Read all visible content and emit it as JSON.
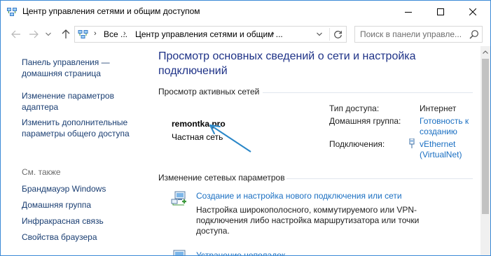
{
  "window": {
    "title": "Центр управления сетями и общим доступом"
  },
  "address": {
    "crumb1": "Все ...",
    "crumb2": "Центр управления сетями и общим ...",
    "search_placeholder": "Поиск в панели управле..."
  },
  "sidebar": {
    "links": [
      {
        "label": "Панель управления —\nдомашняя страница"
      },
      {
        "label": "Изменение параметров\nадаптера"
      },
      {
        "label": "Изменить дополнительные\nпараметры общего доступа"
      }
    ],
    "see_also_heading": "См. также",
    "see_also": [
      {
        "label": "Брандмауэр Windows"
      },
      {
        "label": "Домашняя группа"
      },
      {
        "label": "Инфракрасная связь"
      },
      {
        "label": "Свойства браузера"
      }
    ]
  },
  "main": {
    "title": "Просмотр основных сведений о сети и настройка подключений",
    "active_networks_heading": "Просмотр активных сетей",
    "network": {
      "name": "remontka.pro",
      "type": "Частная сеть"
    },
    "info": {
      "access_label": "Тип доступа:",
      "access_value": "Интернет",
      "homegroup_label": "Домашняя группа:",
      "homegroup_value": "Готовность к созданию",
      "connections_label": "Подключения:",
      "connections_value": "vEthernet (VirtualNet)"
    },
    "change_heading": "Изменение сетевых параметров",
    "tasks": [
      {
        "link": "Создание и настройка нового подключения или сети",
        "desc": "Настройка широкополосного, коммутируемого или VPN-подключения либо настройка маршрутизатора или точки доступа."
      },
      {
        "link": "Устранение неполадок"
      }
    ]
  },
  "colors": {
    "link": "#1a6fc2",
    "nav_link": "#1a3e72",
    "title": "#1e3287",
    "annotation_arrow": "#2a87c8"
  }
}
